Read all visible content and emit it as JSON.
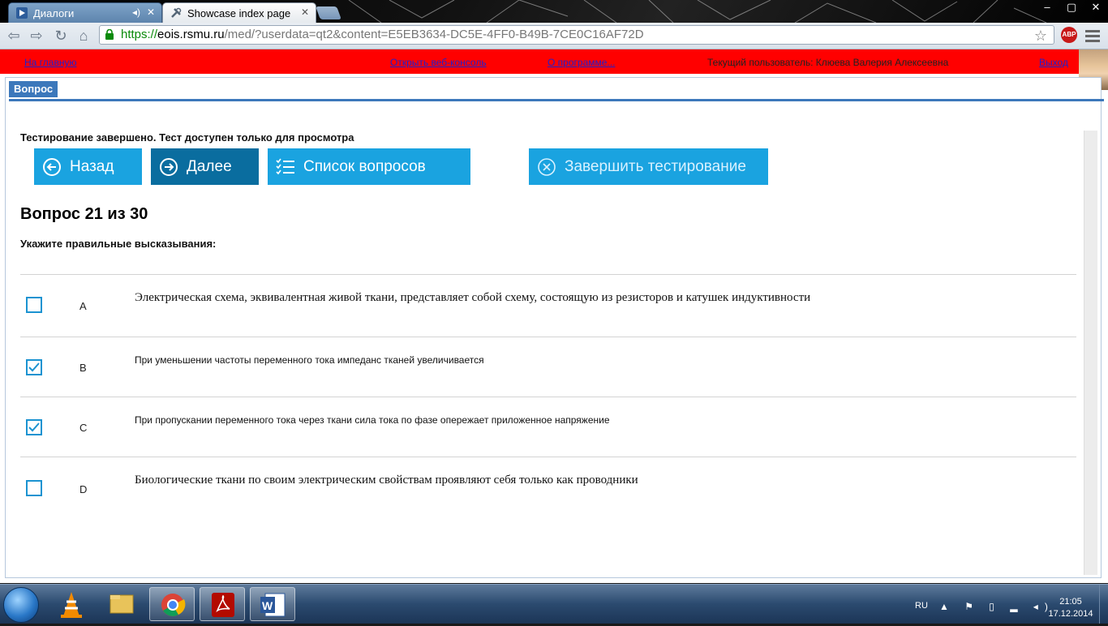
{
  "browser": {
    "tabs": [
      {
        "title": "Диалоги",
        "active": false
      },
      {
        "title": "Showcase index page",
        "active": true
      }
    ],
    "url": {
      "scheme": "https://",
      "host": "eois.rsmu.ru",
      "path": "/med/?userdata=qt2&content=E5EB3634-DC5E-4FF0-B49B-7CE0C16AF72D"
    },
    "extension_badge": "ABP",
    "window_buttons": [
      "–",
      "▢",
      "✕"
    ]
  },
  "header": {
    "home_link": "На главную",
    "console_link": "Открыть веб-консоль",
    "about_link": "О программе...",
    "current_user": "Текущий пользователь: Клюева Валерия Алексеевна",
    "logout_link": "Выход"
  },
  "section_tab": "Вопрос",
  "status_message": "Тестирование завершено. Тест доступен только для просмотра",
  "buttons": {
    "back": "Назад",
    "next": "Далее",
    "list": "Список вопросов",
    "finish": "Завершить тестирование"
  },
  "question": {
    "title": "Вопрос 21 из 30",
    "prompt": "Укажите правильные высказывания:",
    "answers": [
      {
        "label": "A",
        "text": "Электрическая схема, эквивалентная живой ткани, представляет собой схему, состоящую из резисторов и катушек индуктивности",
        "checked": false
      },
      {
        "label": "B",
        "text": "При уменьшении частоты переменного тока импеданс тканей увеличивается",
        "checked": true
      },
      {
        "label": "C",
        "text": "При пропускании переменного тока через ткани сила тока по фазе опережает приложенное напряжение",
        "checked": true
      },
      {
        "label": "D",
        "text": "Биологические ткани по своим электрическим свойствам проявляют себя только как проводники",
        "checked": false
      }
    ]
  },
  "taskbar": {
    "apps": [
      "windows-start",
      "vlc",
      "explorer",
      "chrome",
      "acrobat",
      "word"
    ],
    "language": "RU",
    "time": "21:05",
    "date": "17.12.2014"
  },
  "colors": {
    "header_bg": "#ff0000",
    "button_primary": "#1aa3e0",
    "button_active": "#0a6d9f",
    "section_tab": "#3c78bb",
    "checkbox_border": "#1b93d1"
  }
}
